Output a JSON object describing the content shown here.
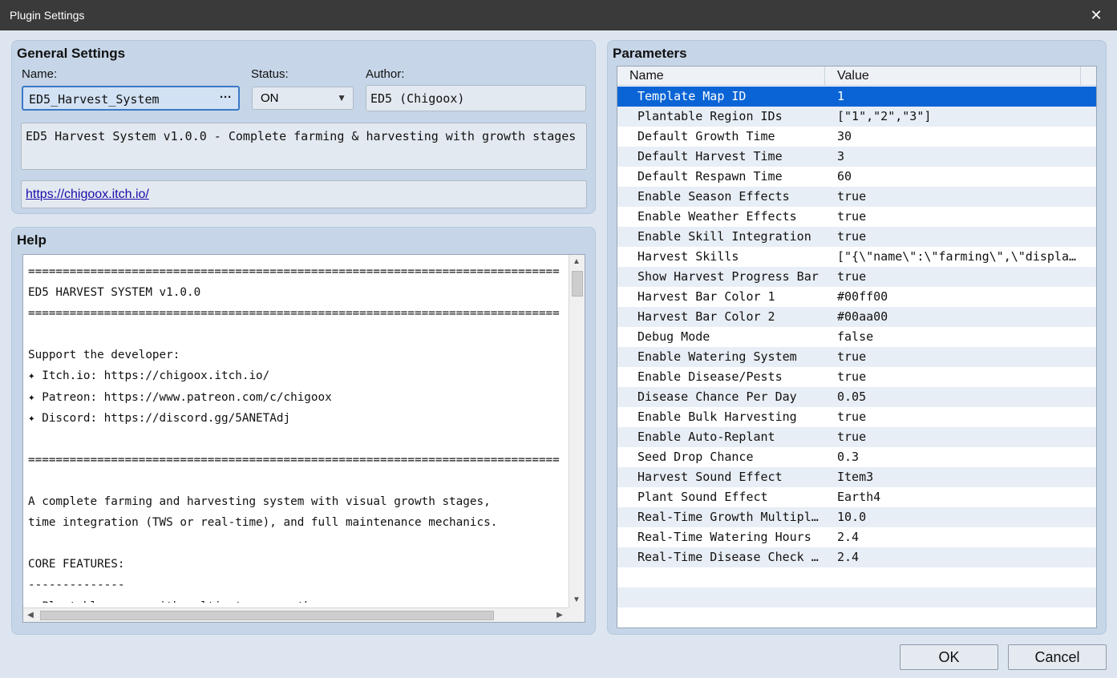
{
  "window": {
    "title": "Plugin Settings",
    "close_glyph": "✕"
  },
  "general": {
    "title": "General Settings",
    "name_label": "Name:",
    "name_value": "ED5_Harvest_System",
    "name_button": "···",
    "status_label": "Status:",
    "status_value": "ON",
    "author_label": "Author:",
    "author_value": "ED5 (Chigoox)",
    "description": "ED5 Harvest System v1.0.0 - Complete farming & harvesting with growth stages",
    "url": "https://chigoox.itch.io/"
  },
  "help": {
    "title": "Help",
    "lines": [
      "=============================================================================",
      "ED5 HARVEST SYSTEM v1.0.0",
      "=============================================================================",
      "",
      "Support the developer:",
      "✦ Itch.io: https://chigoox.itch.io/",
      "✦ Patreon: https://www.patreon.com/c/chigoox",
      "✦ Discord: https://discord.gg/5ANETAdj",
      "",
      "=============================================================================",
      "",
      "A complete farming and harvesting system with visual growth stages,",
      "time integration (TWS or real-time), and full maintenance mechanics.",
      "",
      "CORE FEATURES:",
      "--------------",
      "✓ Plantable crops with multi-stage growth"
    ]
  },
  "parameters": {
    "title": "Parameters",
    "col_name": "Name",
    "col_value": "Value",
    "rows": [
      {
        "name": "Template Map ID",
        "value": "1"
      },
      {
        "name": "Plantable Region IDs",
        "value": "[\"1\",\"2\",\"3\"]"
      },
      {
        "name": "Default Growth Time",
        "value": "30"
      },
      {
        "name": "Default Harvest Time",
        "value": "3"
      },
      {
        "name": "Default Respawn Time",
        "value": "60"
      },
      {
        "name": "Enable Season Effects",
        "value": "true"
      },
      {
        "name": "Enable Weather Effects",
        "value": "true"
      },
      {
        "name": "Enable Skill Integration",
        "value": "true"
      },
      {
        "name": "Harvest Skills",
        "value": "[\"{\\\"name\\\":\\\"farming\\\",\\\"displa…"
      },
      {
        "name": "Show Harvest Progress Bar",
        "value": "true"
      },
      {
        "name": "Harvest Bar Color 1",
        "value": "#00ff00"
      },
      {
        "name": "Harvest Bar Color 2",
        "value": "#00aa00"
      },
      {
        "name": "Debug Mode",
        "value": "false"
      },
      {
        "name": "Enable Watering System",
        "value": "true"
      },
      {
        "name": "Enable Disease/Pests",
        "value": "true"
      },
      {
        "name": "Disease Chance Per Day",
        "value": "0.05"
      },
      {
        "name": "Enable Bulk Harvesting",
        "value": "true"
      },
      {
        "name": "Enable Auto-Replant",
        "value": "true"
      },
      {
        "name": "Seed Drop Chance",
        "value": "0.3"
      },
      {
        "name": "Harvest Sound Effect",
        "value": "Item3"
      },
      {
        "name": "Plant Sound Effect",
        "value": "Earth4"
      },
      {
        "name": "Real-Time Growth Multipl…",
        "value": "10.0"
      },
      {
        "name": "Real-Time Watering Hours",
        "value": "2.4"
      },
      {
        "name": "Real-Time Disease Check …",
        "value": "2.4"
      }
    ]
  },
  "buttons": {
    "ok": "OK",
    "cancel": "Cancel"
  },
  "colors": {
    "selection": "#0a64d6",
    "accent": "#3b78c7"
  }
}
